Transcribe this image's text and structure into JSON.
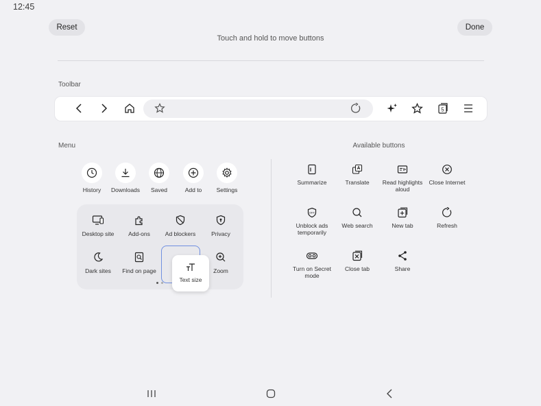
{
  "status": {
    "time": "12:45"
  },
  "header": {
    "reset_label": "Reset",
    "done_label": "Done",
    "hint": "Touch and hold to move buttons"
  },
  "toolbar": {
    "label": "Toolbar",
    "items": [
      "back-icon",
      "forward-icon",
      "home-icon",
      "bookmark-star-icon",
      "refresh-icon",
      "ai-sparkle-icon",
      "bookmarks-icon",
      "tabs-icon",
      "menu-icon"
    ],
    "tabs_count": "5"
  },
  "menu": {
    "label": "Menu",
    "top_items": [
      {
        "label": "History",
        "icon": "clock-icon"
      },
      {
        "label": "Downloads",
        "icon": "download-icon"
      },
      {
        "label": "Saved",
        "icon": "globe-icon"
      },
      {
        "label": "Add to",
        "icon": "plus-circle-icon"
      },
      {
        "label": "Settings",
        "icon": "gear-icon"
      }
    ],
    "panel_items": [
      {
        "label": "Desktop site",
        "icon": "desktop-icon"
      },
      {
        "label": "Add-ons",
        "icon": "puzzle-icon"
      },
      {
        "label": "Ad blockers",
        "icon": "shield-slash-icon"
      },
      {
        "label": "Privacy",
        "icon": "shield-lock-icon"
      },
      {
        "label": "Dark sites",
        "icon": "moon-icon"
      },
      {
        "label": "Find on page",
        "icon": "find-icon"
      },
      {
        "label": "Zoom",
        "icon": "zoom-icon"
      }
    ],
    "dragging": {
      "label": "Text size",
      "icon": "text-size-icon"
    }
  },
  "available": {
    "label": "Available buttons",
    "items": [
      {
        "label": "Summarize",
        "icon": "summarize-icon"
      },
      {
        "label": "Translate",
        "icon": "translate-icon"
      },
      {
        "label": "Read highlights aloud",
        "icon": "read-aloud-icon"
      },
      {
        "label": "Close Internet",
        "icon": "close-circle-icon"
      },
      {
        "label": "Unblock ads temporarily",
        "icon": "unblock-ads-icon"
      },
      {
        "label": "Web search",
        "icon": "search-icon"
      },
      {
        "label": "New tab",
        "icon": "new-tab-icon"
      },
      {
        "label": "Refresh",
        "icon": "refresh-icon"
      },
      {
        "label": "Turn on Secret mode",
        "icon": "secret-mode-icon"
      },
      {
        "label": "Close tab",
        "icon": "close-tab-icon"
      },
      {
        "label": "Share",
        "icon": "share-icon"
      }
    ]
  },
  "colors": {
    "accent": "#6f8fe0",
    "background": "#f1f1f4"
  }
}
